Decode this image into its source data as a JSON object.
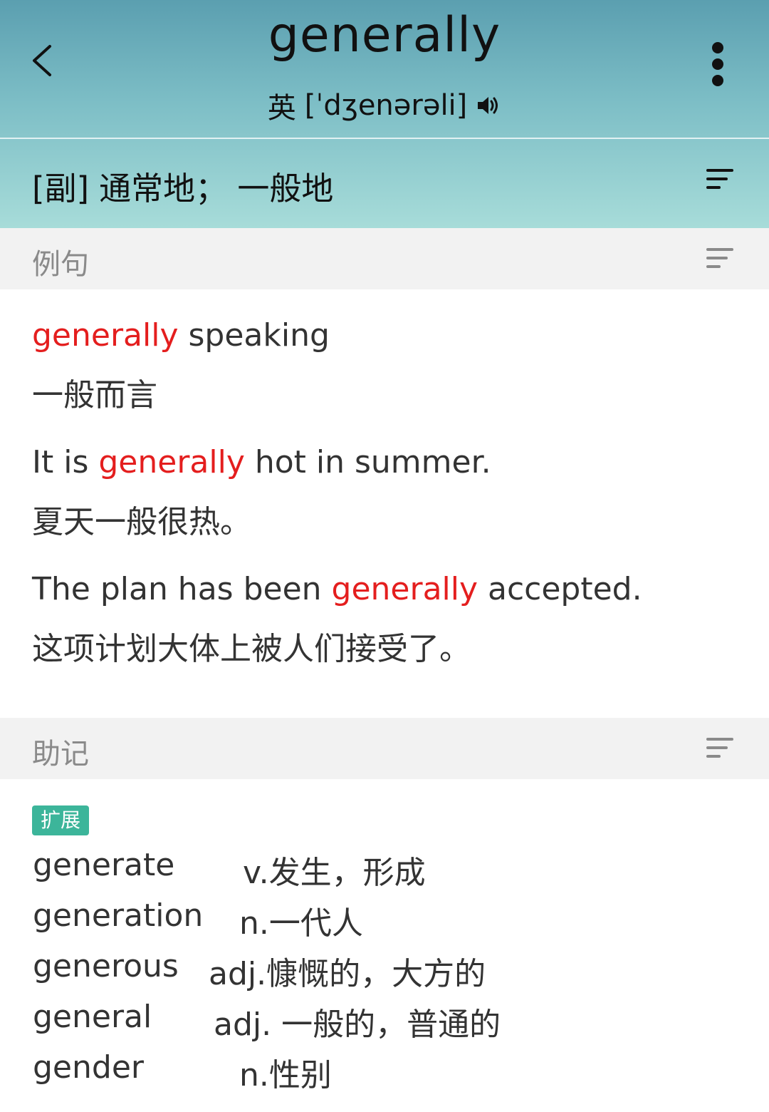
{
  "header": {
    "word": "generally",
    "phonetic_label": "英",
    "phonetic": "[ˈdʒenərəli]",
    "definition_pos": "[副]",
    "definition": "通常地；  一般地"
  },
  "sections": {
    "examples_title": "例句",
    "mnemonic_title": "助记"
  },
  "examples": [
    {
      "pre": "",
      "hl": "generally",
      "post": " speaking",
      "cn": "一般而言"
    },
    {
      "pre": "It is ",
      "hl": "generally",
      "post": " hot in summer.",
      "cn": "夏天一般很热。"
    },
    {
      "pre": "The plan has been ",
      "hl": "generally",
      "post": " accepted.",
      "cn": "这项计划大体上被人们接受了。"
    }
  ],
  "mnemonic": {
    "tag": "扩展",
    "items": [
      {
        "word": "generate",
        "meaning": "v.发生，形成"
      },
      {
        "word": "generation",
        "meaning": "n.一代人"
      },
      {
        "word": "generous",
        "meaning": "adj.慷慨的，大方的"
      },
      {
        "word": "general",
        "meaning": "adj. 一般的，普通的"
      },
      {
        "word": "gender",
        "meaning": "n.性别"
      }
    ]
  },
  "colors": {
    "highlight": "#e41e1e",
    "tag": "#3cb59a",
    "header_top": "#5b9fb0",
    "header_bottom": "#a7dcd9"
  },
  "icons": [
    "back-arrow-icon",
    "more-vertical-icon",
    "speaker-icon",
    "sort-lines-icon"
  ]
}
